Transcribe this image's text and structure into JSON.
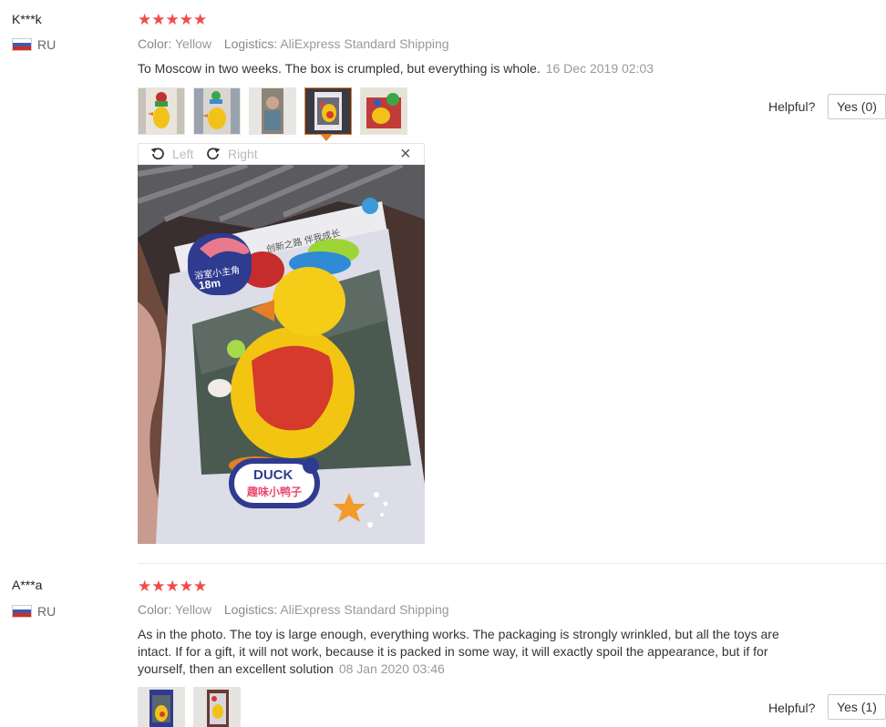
{
  "reviews": [
    {
      "name": "K***k",
      "country": "RU",
      "stars": "★★★★★",
      "color_label": "Color:",
      "color_value": "Yellow",
      "logistics_label": "Logistics:",
      "logistics_value": "AliExpress Standard Shipping",
      "text": "To Moscow in two weeks. The box is crumpled, but everything is whole.",
      "date": "16 Dec 2019 02:03",
      "helpful_label": "Helpful?",
      "yes_label": "Yes (0)"
    },
    {
      "name": "A***a",
      "country": "RU",
      "stars": "★★★★★",
      "color_label": "Color:",
      "color_value": "Yellow",
      "logistics_label": "Logistics:",
      "logistics_value": "AliExpress Standard Shipping",
      "text_line1": "As in the photo. The toy is large enough, everything works. The packaging is strongly wrinkled, but all the toys are",
      "text_line2": "intact. If for a gift, it will not work, because it is packed in some way, it will exactly spoil the appearance, but if for",
      "text_line3": "yourself, then an excellent solution",
      "date": "08 Jan 2020 03:46",
      "helpful_label": "Helpful?",
      "yes_label": "Yes (1)"
    }
  ],
  "viewer": {
    "left_label": "Left",
    "right_label": "Right",
    "close_glyph": "×",
    "package_brand": "DUCK",
    "package_subtitle": "趣味小鸭子",
    "package_tagline": "创新之路 伴我成长",
    "package_badge_text": "浴室小主角",
    "package_age": "18m"
  },
  "icons": {
    "rotate_left": "rotate-left-icon",
    "rotate_right": "rotate-right-icon",
    "close": "close-icon",
    "flag": "flag-ru-icon",
    "star": "star-icon"
  },
  "colors": {
    "star": "#f24a4a",
    "active_thumb_border": "#e67e22",
    "muted_text": "#999999"
  }
}
